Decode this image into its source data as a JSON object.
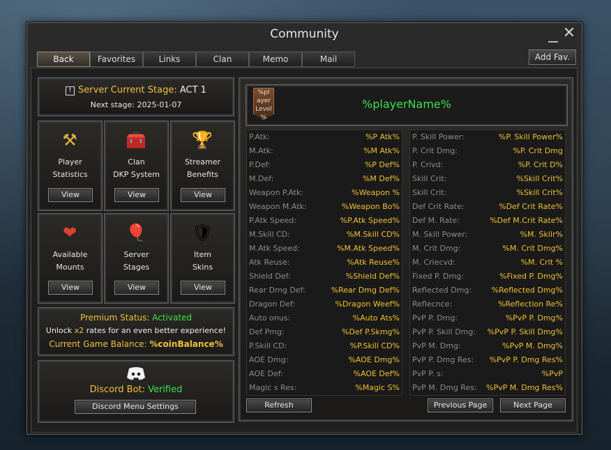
{
  "window": {
    "title": "Community"
  },
  "tabs": [
    {
      "label": "Back",
      "active": true
    },
    {
      "label": "Favorites",
      "active": false
    },
    {
      "label": "Links",
      "active": false
    },
    {
      "label": "Clan",
      "active": false
    },
    {
      "label": "Memo",
      "active": false
    },
    {
      "label": "Mail",
      "active": false
    }
  ],
  "add_fav_label": "Add Fav.",
  "stage": {
    "title_prefix": "Server Current Stage: ",
    "title_value": "ACT 1",
    "next": "Next stage: 2025-01-07"
  },
  "tiles": [
    {
      "label": "Player\nStatistics",
      "icon": "crossed-hammers-icon",
      "glyph": "⚒",
      "button": "View"
    },
    {
      "label": "Clan\nDKP System",
      "icon": "treasure-chest-icon",
      "glyph": "🧰",
      "button": "View"
    },
    {
      "label": "Streamer\nBenefits",
      "icon": "trophy-icon",
      "glyph": "🏆",
      "button": "View"
    },
    {
      "label": "Available\nMounts",
      "icon": "heart-wings-icon",
      "glyph": "❤",
      "button": "View"
    },
    {
      "label": "Server\nStages",
      "icon": "balloons-icon",
      "glyph": "🎈",
      "button": "View"
    },
    {
      "label": "Item\nSkins",
      "icon": "armor-icon",
      "glyph": "🛡",
      "button": "View"
    }
  ],
  "premium": {
    "status_label": "Premium Status: ",
    "status_value": "Activated",
    "unlock_pre": "Unlock ",
    "unlock_mult": "x2",
    "unlock_post": " rates for an even better experience!",
    "balance_label": "Current Game Balance: ",
    "balance_value": "%coinBalance%"
  },
  "discord": {
    "bot_label": "Discord Bot: ",
    "bot_status": "Verified",
    "settings_button": "Discord Menu Settings",
    "icon": "discord-icon"
  },
  "player": {
    "name": "%playerName%",
    "level_banner": "%pl ayer Level %"
  },
  "stats_left": [
    {
      "label": "P.Atk:",
      "value": "%P Atk%"
    },
    {
      "label": "M.Atk:",
      "value": "%M Atk%"
    },
    {
      "label": "P.Def:",
      "value": "%P Def%"
    },
    {
      "label": "M.Def:",
      "value": "%M Def%"
    },
    {
      "label": "Weapon  P.Atk:",
      "value": "%Weapon %"
    },
    {
      "label": "Weapon  M.Atk:",
      "value": "%Weapon Bo%"
    },
    {
      "label": "P.Atk Speed:",
      "value": "%P.Atk Speed%"
    },
    {
      "label": "M.Skill CD:",
      "value": "%M.Skill CD%"
    },
    {
      "label": "M.Atk Speed:",
      "value": "%M.Atk Speed%"
    },
    {
      "label": "Atk Reuse:",
      "value": "%Atk Reuse%"
    },
    {
      "label": "Shield Def:",
      "value": "%Shield Def%"
    },
    {
      "label": "Rear Dmg Def:",
      "value": "%Rear Dmg Def%"
    },
    {
      "label": "Dragon Def:",
      "value": "%Dragon Weef%"
    },
    {
      "label": "Auto onus:",
      "value": "%Auto Ats%"
    },
    {
      "label": "Def Pmg:",
      "value": "%Def P.Skmg%"
    },
    {
      "label": "P.Skill CD:",
      "value": "%P.Skill CD%"
    },
    {
      "label": "AOE Dmg:",
      "value": "%AOE Dmg%"
    },
    {
      "label": "AOE Def:",
      "value": "%AOE Def%"
    },
    {
      "label": "Magic s Res:",
      "value": "%Magic S%"
    }
  ],
  "stats_right": [
    {
      "label": "P. Skill Power:",
      "value": "%P. Skill Power%"
    },
    {
      "label": "P. Crit Dmg:",
      "value": "%P. Crit Dmg"
    },
    {
      "label": "P. Crivd:",
      "value": "%P. Crit D%"
    },
    {
      "label": "Skill Crit:",
      "value": "%Skill Crit%"
    },
    {
      "label": "Skill Crit:",
      "value": "%Skill Crit%"
    },
    {
      "label": "Def Crit Rate:",
      "value": "%Def Crit Rate%"
    },
    {
      "label": "Def M. Rate:",
      "value": "%Def M.Crit Rate%"
    },
    {
      "label": "M. Skill Power:",
      "value": "%M. Skilr%"
    },
    {
      "label": "M. Crit Dmg:",
      "value": "%M. Crit Dmg%"
    },
    {
      "label": "M. Criecvd:",
      "value": "%M. Crit %"
    },
    {
      "label": "Fixed P. Dmg:",
      "value": "%Fixed P. Dmg%"
    },
    {
      "label": "Reflected Dmg:",
      "value": "%Reflected Dmg%"
    },
    {
      "label": "Reflecnce:",
      "value": "%Reflection Re%"
    },
    {
      "label": "PvP P. Dmg:",
      "value": "%PvP P. Dmg%"
    },
    {
      "label": "PvP P. Skill Dmg:",
      "value": "%PvP P. Skill Dmg%"
    },
    {
      "label": "PvP M. Dmg:",
      "value": "%PvP M. Dmg%"
    },
    {
      "label": "PvP P. Dmg Res:",
      "value": "%PvP P. Dmg Res%"
    },
    {
      "label": "PvP P. s:",
      "value": "%PvP"
    },
    {
      "label": "PvP M. Dmg Res:",
      "value": "%PvP M. Dmg Res%"
    }
  ],
  "buttons": {
    "refresh": "Refresh",
    "prev": "Previous Page",
    "next": "Next Page"
  }
}
